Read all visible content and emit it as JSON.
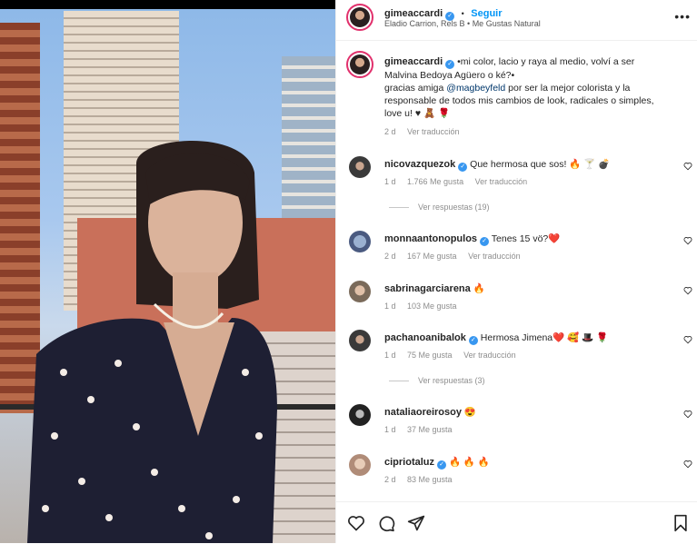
{
  "post": {
    "username": "gimeaccardi",
    "follow_label": "Seguir",
    "dot": "•",
    "audio": "Eladio Carrion, Rels B • Me Gustas Natural",
    "caption_line1": "•mi color, lacio y raya al medio, volví a ser",
    "caption_line2": "Malvina Bedoya Agüero o ké?•",
    "caption_line3_prefix": "gracias amiga ",
    "caption_mention": "@magbeyfeld",
    "caption_line3_suffix": " por ser la mejor colorista y la",
    "caption_line4": "responsable de todos mis cambios de look, radicales o simples,",
    "caption_line5": "love u! ♥ 🧸 🌹",
    "time": "2 d",
    "translate": "Ver traducción"
  },
  "comments": [
    {
      "user": "nicovazquezok",
      "verified": true,
      "text": "Que hermosa que sos! 🔥 🍸 💣",
      "time": "1 d",
      "likes": "1.766 Me gusta",
      "translate": "Ver traducción",
      "replies": "Ver respuestas (19)"
    },
    {
      "user": "monnaantonopulos",
      "verified": true,
      "text": "Tenes 15 vö?❤️",
      "time": "2 d",
      "likes": "167 Me gusta",
      "translate": "Ver traducción",
      "replies": ""
    },
    {
      "user": "sabrinagarciarena",
      "verified": false,
      "text": "🔥",
      "time": "1 d",
      "likes": "103 Me gusta",
      "translate": "",
      "replies": ""
    },
    {
      "user": "pachanoanibalok",
      "verified": true,
      "text": "Hermosa Jimena❤️ 🥰 🎩 🌹",
      "time": "1 d",
      "likes": "75 Me gusta",
      "translate": "Ver traducción",
      "replies": "Ver respuestas (3)"
    },
    {
      "user": "nataliaoreirosoy",
      "verified": false,
      "text": "😍",
      "time": "1 d",
      "likes": "37 Me gusta",
      "translate": "",
      "replies": ""
    },
    {
      "user": "cipriotaluz",
      "verified": true,
      "text": "🔥 🔥 🔥",
      "time": "2 d",
      "likes": "83 Me gusta",
      "translate": "",
      "replies": ""
    }
  ],
  "icons": {
    "more": "more-icon",
    "heart": "heart-icon",
    "comment": "comment-icon",
    "share": "share-icon",
    "save": "bookmark-icon"
  },
  "colors": {
    "accent": "#0095f6",
    "verified": "#3897f0",
    "mention": "#00376b"
  }
}
